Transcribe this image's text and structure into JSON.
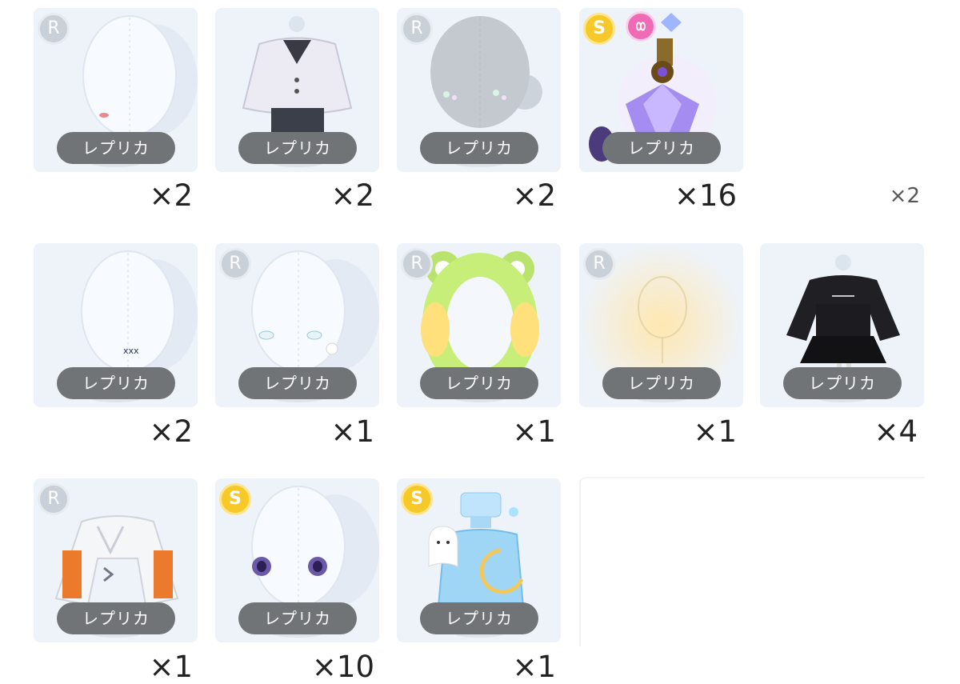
{
  "items": [
    {
      "badge": "R",
      "badge_icon": "r-rarity-icon",
      "label": "レプリカ",
      "count": "×2",
      "art": "mannequin-head-mouth"
    },
    {
      "badge": "",
      "label": "レプリカ",
      "count": "×2",
      "art": "white-cardigan-outfit"
    },
    {
      "badge": "R",
      "badge_icon": "r-rarity-icon",
      "label": "レプリカ",
      "count": "×2",
      "art": "grey-head-sparkle-makeup"
    },
    {
      "badge": "S",
      "badge_icon": "s-rarity-icon",
      "extra_icon": "infinity-heart-icon",
      "label": "レプリカ",
      "count": "×16",
      "art": "purple-perfume-bottle"
    },
    {
      "badge": "",
      "label": "",
      "count": "×2",
      "art": "none",
      "partial": true
    },
    {
      "badge": "",
      "label": "レプリカ",
      "count": "×2",
      "art": "mannequin-head-xxx-sticker"
    },
    {
      "badge": "R",
      "badge_icon": "r-rarity-icon",
      "label": "レプリカ",
      "count": "×1",
      "art": "mannequin-head-cloud-earrings"
    },
    {
      "badge": "R",
      "badge_icon": "r-rarity-icon",
      "label": "レプリカ",
      "count": "×1",
      "art": "green-frog-hood"
    },
    {
      "badge": "R",
      "badge_icon": "r-rarity-icon",
      "label": "レプリカ",
      "count": "×1",
      "art": "golden-glow-aura"
    },
    {
      "badge": "",
      "label": "レプリカ",
      "count": "×4",
      "art": "black-dress-outfit"
    },
    {
      "badge": "R",
      "badge_icon": "r-rarity-icon",
      "label": "レプリカ",
      "count": "×1",
      "art": "white-orange-jacket"
    },
    {
      "badge": "S",
      "badge_icon": "s-rarity-icon",
      "label": "レプリカ",
      "count": "×10",
      "art": "mannequin-head-purple-eyes"
    },
    {
      "badge": "S",
      "badge_icon": "s-rarity-icon",
      "label": "レプリカ",
      "count": "×1",
      "art": "blue-ghost-perfume-bottle"
    }
  ],
  "colors": {
    "card_bg": "#eef3f9",
    "pill_bg": "#707477",
    "r_badge": "#c9d0d8",
    "s_badge": "#f6c928",
    "heart_badge": "#f06bb6"
  }
}
